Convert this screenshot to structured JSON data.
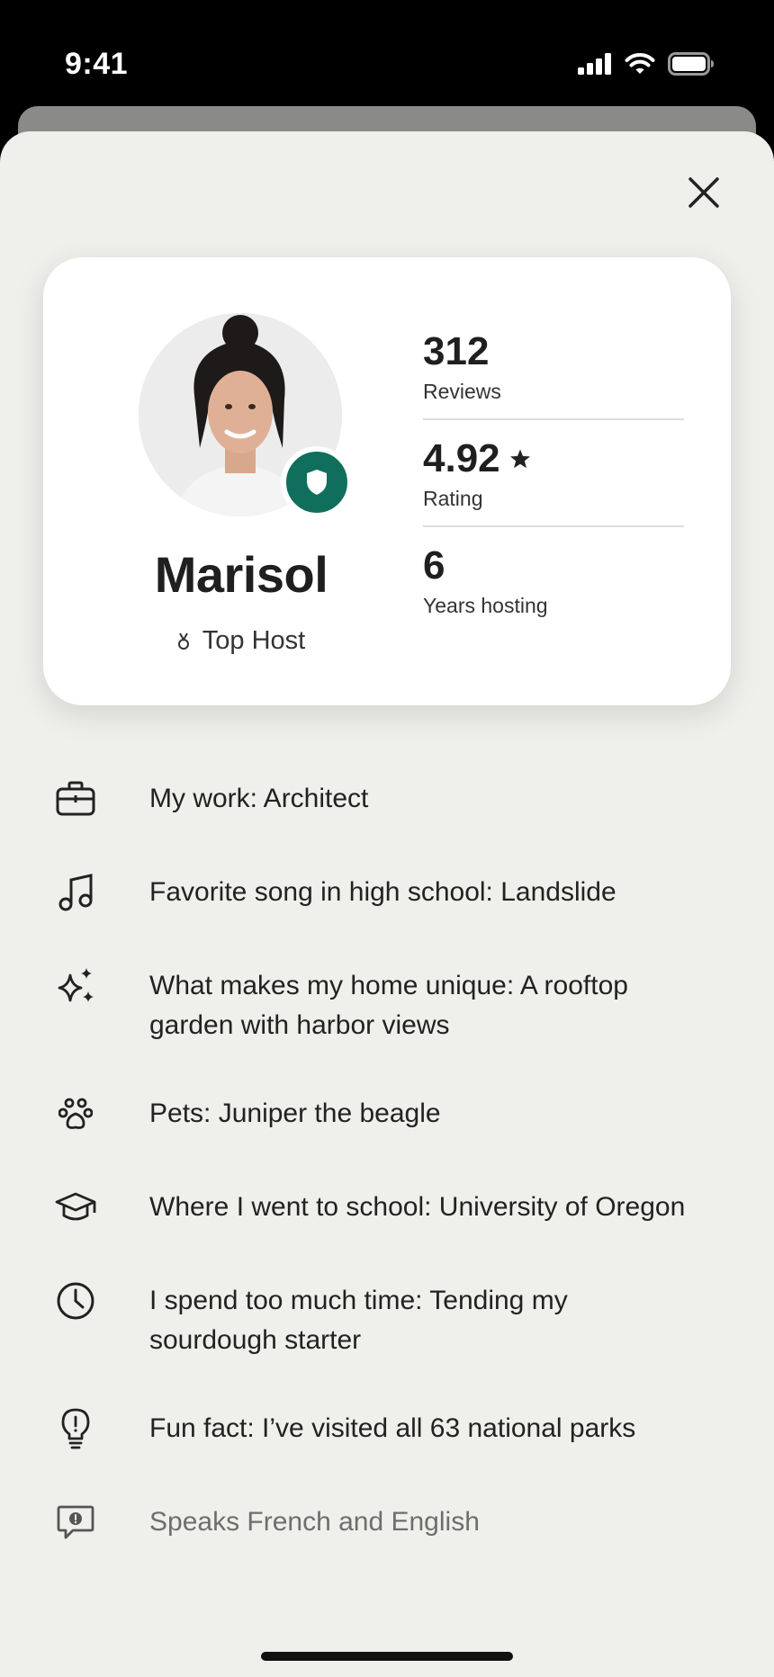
{
  "status_bar": {
    "time": "9:41"
  },
  "profile": {
    "name": "Marisol",
    "badge_label": "Top Host",
    "stats": [
      {
        "value": "312",
        "label": "Reviews"
      },
      {
        "value": "4.92",
        "label": "Rating"
      },
      {
        "value": "6",
        "label": "Years hosting"
      }
    ]
  },
  "facts": [
    {
      "icon": "briefcase-icon",
      "text": "My work: Architect"
    },
    {
      "icon": "music-note-icon",
      "text": "Favorite song in high school: Landslide"
    },
    {
      "icon": "sparkles-icon",
      "text": "What makes my home unique: A rooftop garden with harbor views"
    },
    {
      "icon": "paw-icon",
      "text": "Pets: Juniper the beagle"
    },
    {
      "icon": "graduation-cap-icon",
      "text": "Where I went to school: University of Oregon"
    },
    {
      "icon": "clock-icon",
      "text": "I spend too much time: Tending my sourdough starter"
    },
    {
      "icon": "lightbulb-icon",
      "text": "Fun fact: I’ve visited all 63 national parks"
    },
    {
      "icon": "speech-bubble-icon",
      "text": "Speaks French and English"
    }
  ],
  "colors": {
    "accent": "#0f6f5c",
    "sheet": "#efefec",
    "card": "#ffffff"
  }
}
